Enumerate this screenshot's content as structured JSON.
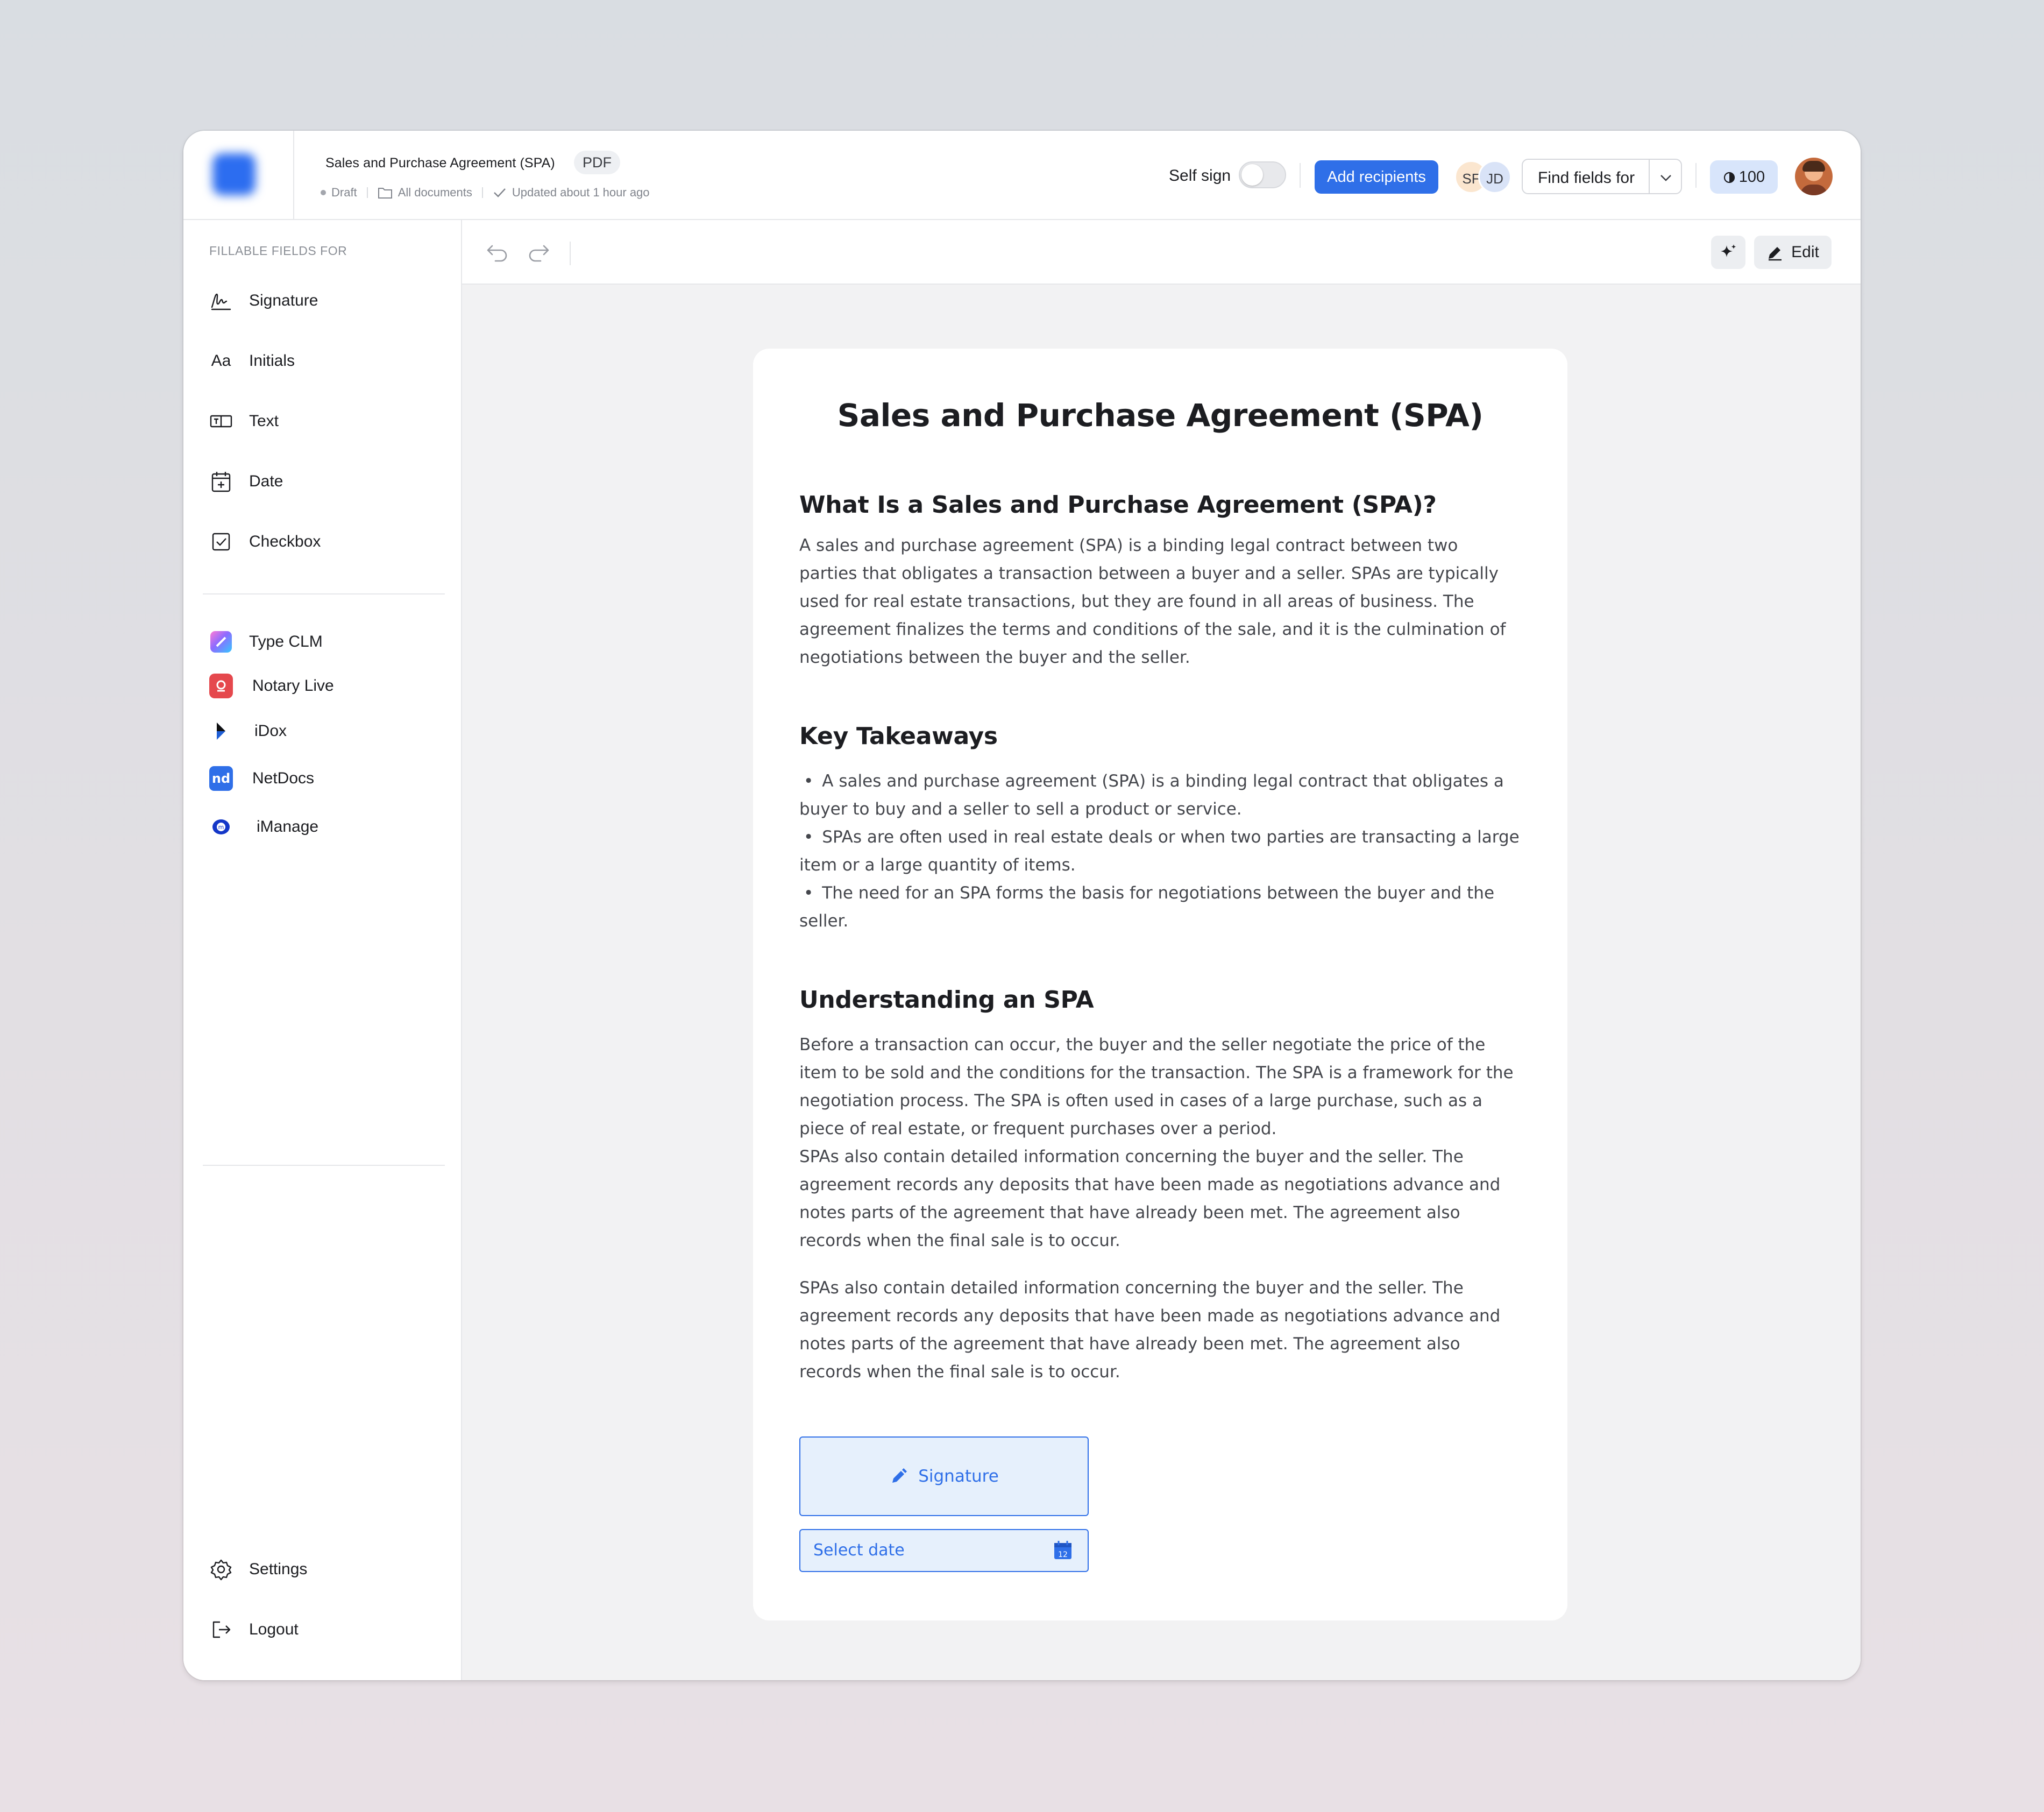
{
  "header": {
    "title": "Sales and Purchase Agreement (SPA)",
    "file_type": "PDF",
    "status": "Draft",
    "folder": "All documents",
    "updated": "Updated about 1 hour ago",
    "self_sign_label": "Self sign",
    "self_sign_on": false,
    "add_recipients_label": "Add recipients",
    "recipients": [
      "SF",
      "JD"
    ],
    "find_fields_label": "Find fields for",
    "credits": "100"
  },
  "sidebar": {
    "caption": "FILLABLE FIELDS FOR",
    "fields": [
      {
        "label": "Signature",
        "icon": "signature-icon"
      },
      {
        "label": "Initials",
        "icon": "initials-icon"
      },
      {
        "label": "Text",
        "icon": "text-field-icon"
      },
      {
        "label": "Date",
        "icon": "calendar-icon"
      },
      {
        "label": "Checkbox",
        "icon": "checkbox-icon"
      }
    ],
    "integrations": [
      {
        "label": "Type CLM",
        "icon": "type-clm-icon"
      },
      {
        "label": "Notary Live",
        "icon": "notary-live-icon"
      },
      {
        "label": "iDox",
        "icon": "idox-icon"
      },
      {
        "label": "NetDocs",
        "icon": "netdocs-icon"
      },
      {
        "label": "iManage",
        "icon": "imanage-icon"
      }
    ],
    "settings_label": "Settings",
    "logout_label": "Logout"
  },
  "toolbar": {
    "edit_label": "Edit"
  },
  "document": {
    "title": "Sales and Purchase Agreement (SPA)",
    "section1_heading": "What Is a Sales and Purchase Agreement (SPA)?",
    "section1_text": "A sales and purchase agreement (SPA) is a binding legal contract between two parties that obligates a transaction between a buyer and a seller. SPAs are typically used for real estate transactions, but they are found in all areas of business. The agreement finalizes the terms and conditions of the sale, and it is the culmination of negotiations between the buyer and the seller.",
    "section2_heading": "Key Takeaways",
    "takeaways": [
      "A sales and purchase agreement (SPA) is a binding legal contract that obligates a buyer to buy and a seller to sell a product or service.",
      "SPAs are often used in real estate deals or when two parties are transacting a large item or a large quantity of items.",
      "The need for an SPA forms the basis for negotiations between the buyer and the seller."
    ],
    "section3_heading": "Understanding an SPA",
    "section3_text1": "Before a transaction can occur, the buyer and the seller negotiate the price of the item to be sold and the conditions for the transaction. The SPA is a framework for the negotiation process. The SPA is often used in cases of a large purchase, such as a piece of real estate, or frequent purchases over a period.",
    "section3_text2": "SPAs also contain detailed information concerning the buyer and the seller. The agreement records any deposits that have been made as negotiations advance and notes parts of the agreement that have already been met. The agreement also records when the final sale is to occur.",
    "section3_text3": "SPAs also contain detailed information concerning the buyer and the seller. The agreement records any deposits that have been made as negotiations advance and notes parts of the agreement that have already been met. The agreement also records when the final sale is to occur.",
    "signature_field_label": "Signature",
    "date_field_placeholder": "Select date",
    "calendar_day": "12"
  },
  "colors": {
    "accent": "#2f6fe8",
    "field_fill": "#e6f0fc",
    "canvas": "#f2f2f3"
  }
}
